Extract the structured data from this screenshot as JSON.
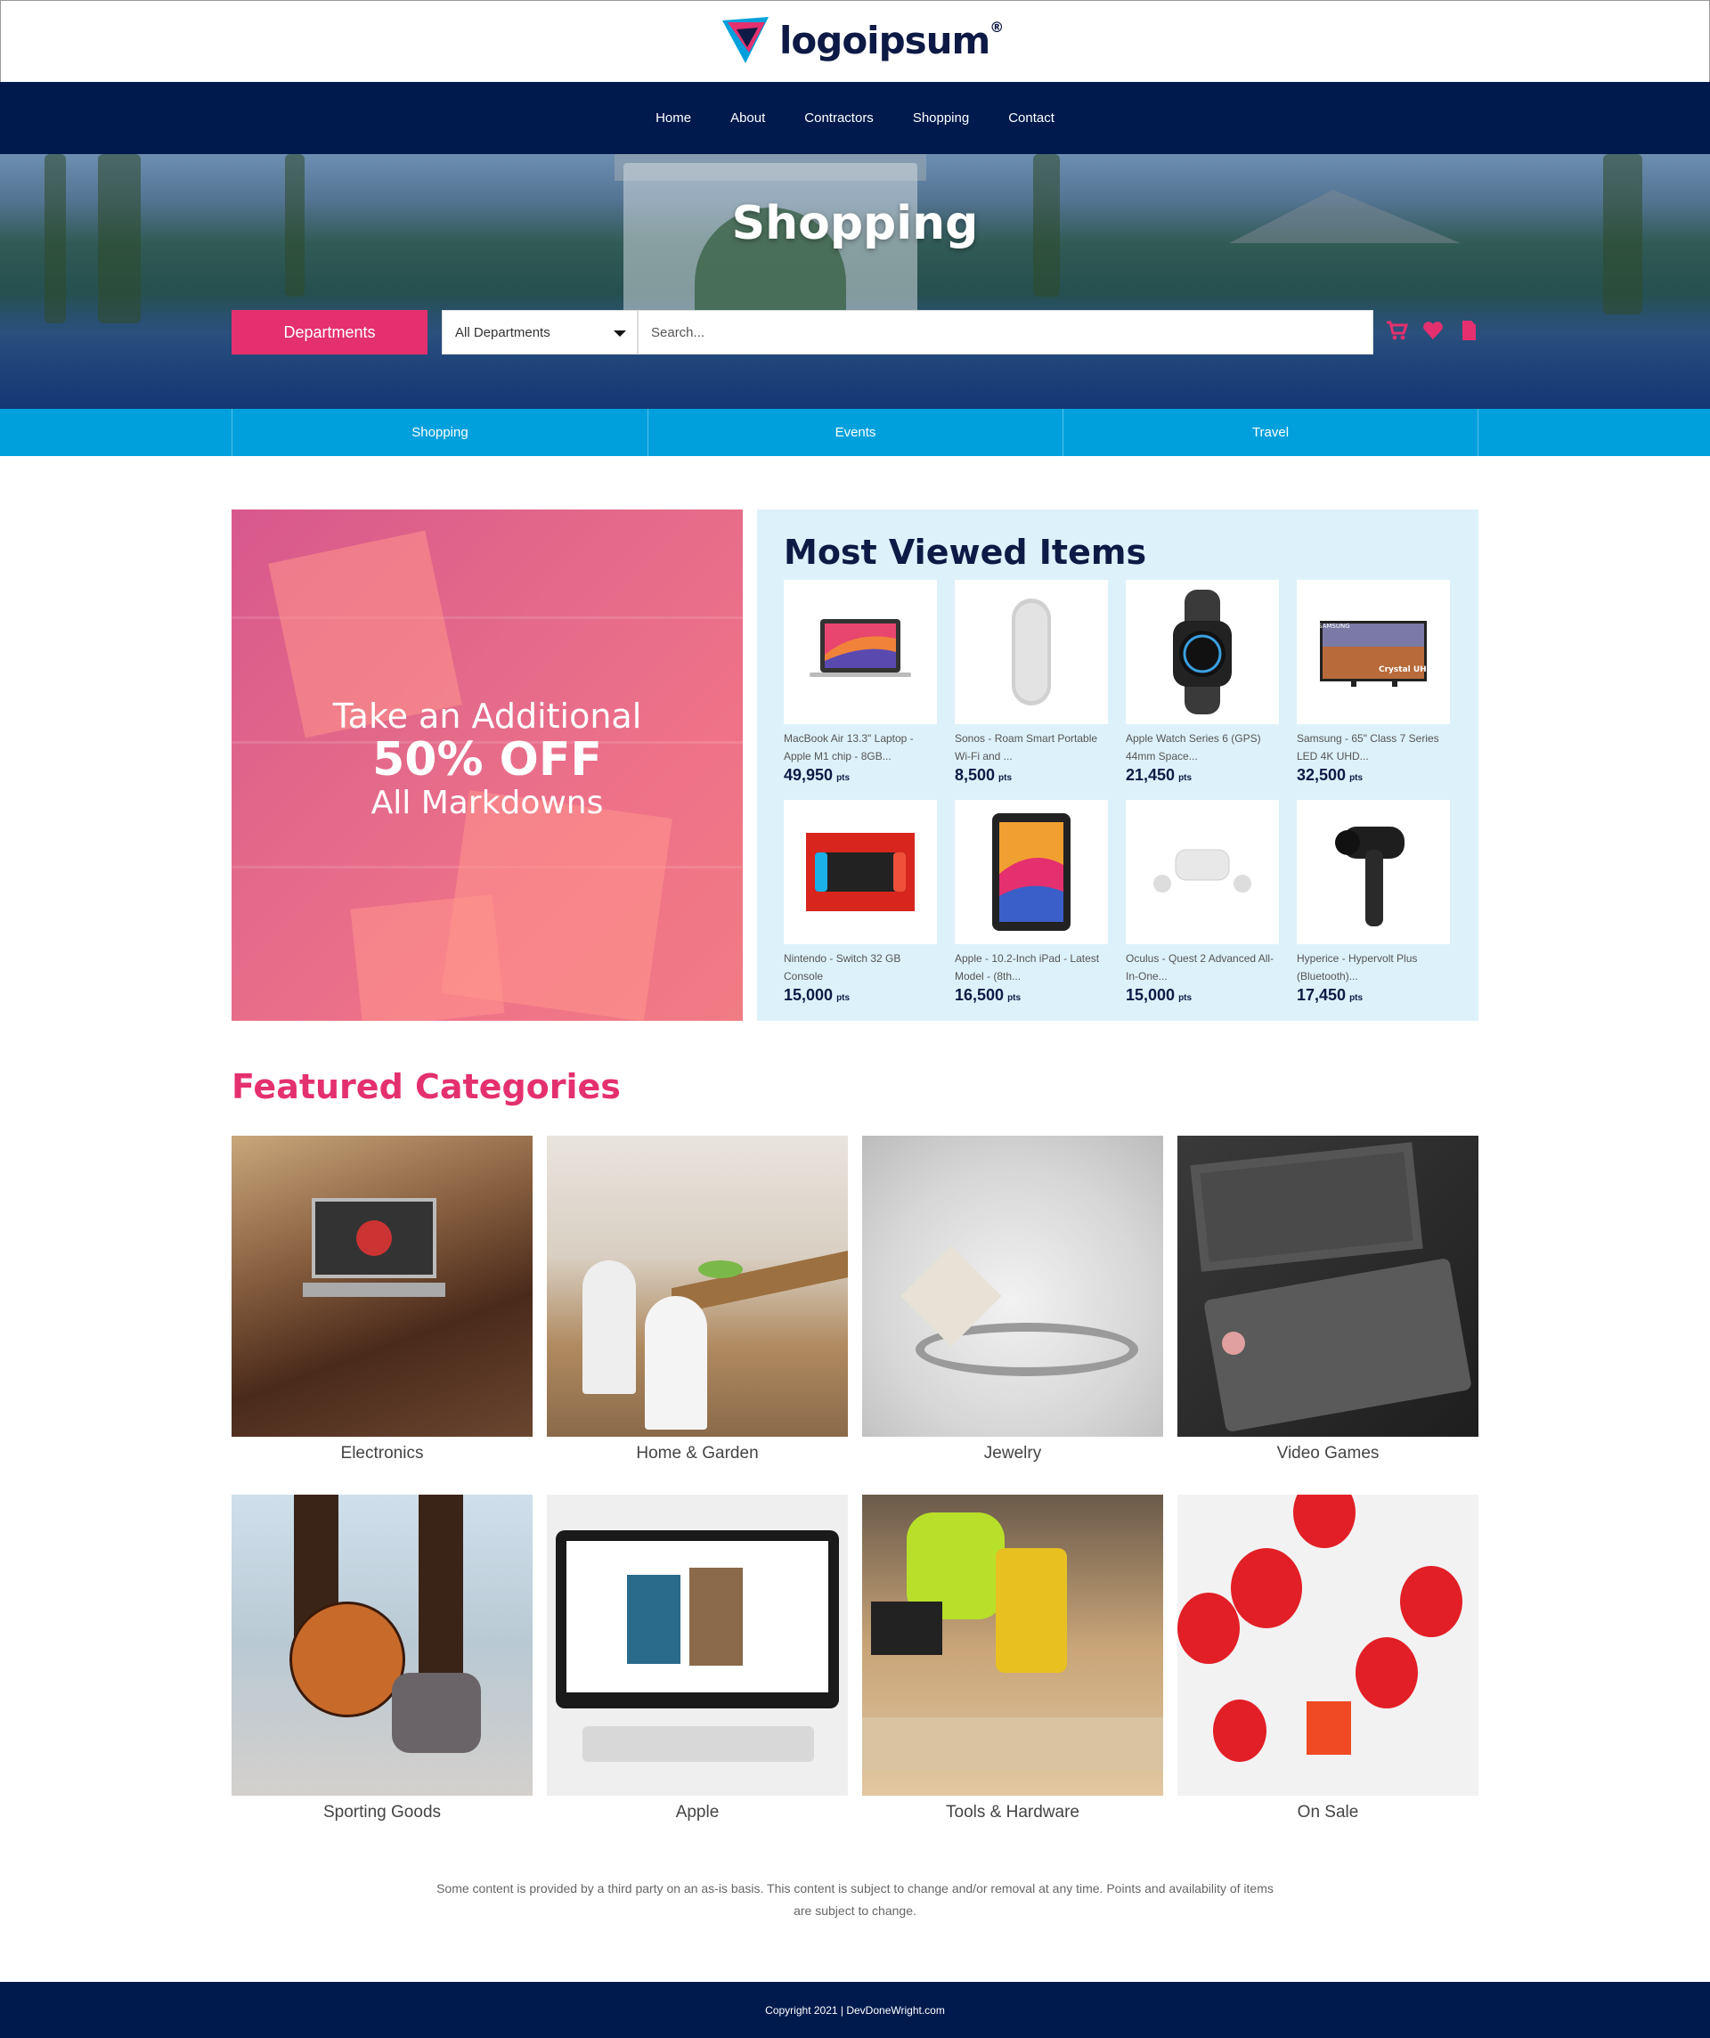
{
  "brand": {
    "name": "logoipsum",
    "mark": "®"
  },
  "nav": [
    "Home",
    "About",
    "Contractors",
    "Shopping",
    "Contact"
  ],
  "hero": {
    "title": "Shopping",
    "departments_button": "Departments",
    "department_select": "All Departments",
    "search_placeholder": "Search...",
    "icons": [
      "cart-icon",
      "heart-icon",
      "document-icon"
    ]
  },
  "subnav": [
    "Shopping",
    "Events",
    "Travel"
  ],
  "promo": {
    "line1": "Take an Additional",
    "line2": "50% OFF",
    "line3": "All Markdowns"
  },
  "most_viewed": {
    "title": "Most Viewed Items",
    "items": [
      {
        "name": "MacBook Air 13.3\" Laptop - Apple M1 chip - 8GB...",
        "price": "49,950",
        "unit": "pts"
      },
      {
        "name": "Sonos - Roam Smart Portable Wi-Fi and ...",
        "price": "8,500",
        "unit": "pts"
      },
      {
        "name": "Apple Watch Series 6 (GPS) 44mm Space...",
        "price": "21,450",
        "unit": "pts"
      },
      {
        "name": "Samsung - 65\" Class 7 Series LED 4K UHD...",
        "price": "32,500",
        "unit": "pts"
      },
      {
        "name": "Nintendo - Switch 32 GB Console",
        "price": "15,000",
        "unit": "pts"
      },
      {
        "name": "Apple - 10.2-Inch iPad - Latest Model - (8th...",
        "price": "16,500",
        "unit": "pts"
      },
      {
        "name": "Oculus - Quest 2 Advanced All-In-One...",
        "price": "15,000",
        "unit": "pts"
      },
      {
        "name": "Hyperice - Hypervolt Plus (Bluetooth)...",
        "price": "17,450",
        "unit": "pts"
      }
    ],
    "tv_label": "Crystal UHD",
    "tv_brand": "SAMSUNG"
  },
  "featured": {
    "title": "Featured Categories",
    "categories": [
      "Electronics",
      "Home & Garden",
      "Jewelry",
      "Video Games",
      "Sporting Goods",
      "Apple",
      "Tools & Hardware",
      "On Sale"
    ]
  },
  "disclaimer": "Some content is provided by a third party on an as-is basis. This content is subject to change and/or removal at any time. Points and availability of items are subject to change.",
  "footer": "Copyright 2021 | DevDoneWright.com",
  "colors": {
    "navy": "#001a4d",
    "pink": "#e4306f",
    "cyan": "#00a0dc",
    "light_blue": "#ddf1fa"
  }
}
